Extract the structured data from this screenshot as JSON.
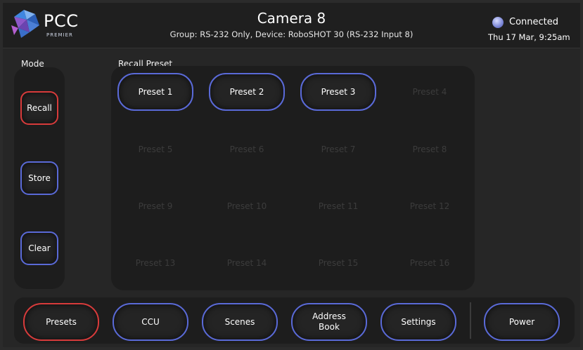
{
  "header": {
    "logo_text": "PCC",
    "logo_sub": "PREMIER",
    "title": "Camera 8",
    "subtitle": "Group: RS-232 Only, Device: RoboSHOT 30 (RS-232 Input 8)",
    "status": "Connected",
    "datetime": "Thu 17 Mar, 9:25am",
    "status_color": "#7b86d6"
  },
  "mode": {
    "label": "Mode",
    "buttons": [
      {
        "label": "Recall",
        "active": true
      },
      {
        "label": "Store",
        "active": false
      },
      {
        "label": "Clear",
        "active": false
      }
    ]
  },
  "presets": {
    "label": "Recall Preset",
    "items": [
      {
        "label": "Preset 1",
        "enabled": true
      },
      {
        "label": "Preset 2",
        "enabled": true
      },
      {
        "label": "Preset 3",
        "enabled": true
      },
      {
        "label": "Preset 4",
        "enabled": false
      },
      {
        "label": "Preset 5",
        "enabled": false
      },
      {
        "label": "Preset 6",
        "enabled": false
      },
      {
        "label": "Preset 7",
        "enabled": false
      },
      {
        "label": "Preset 8",
        "enabled": false
      },
      {
        "label": "Preset 9",
        "enabled": false
      },
      {
        "label": "Preset 10",
        "enabled": false
      },
      {
        "label": "Preset 11",
        "enabled": false
      },
      {
        "label": "Preset 12",
        "enabled": false
      },
      {
        "label": "Preset 13",
        "enabled": false
      },
      {
        "label": "Preset 14",
        "enabled": false
      },
      {
        "label": "Preset 15",
        "enabled": false
      },
      {
        "label": "Preset 16",
        "enabled": false
      }
    ]
  },
  "nav": [
    {
      "label": "Presets",
      "active": true
    },
    {
      "label": "CCU",
      "active": false
    },
    {
      "label": "Scenes",
      "active": false
    },
    {
      "label": "Address\nBook",
      "active": false
    },
    {
      "label": "Settings",
      "active": false
    },
    {
      "label": "Power",
      "active": false
    }
  ],
  "colors": {
    "accent": "#5a6ad8",
    "active": "#d83b3b",
    "panel": "#1d1d1d",
    "background": "#262626"
  }
}
